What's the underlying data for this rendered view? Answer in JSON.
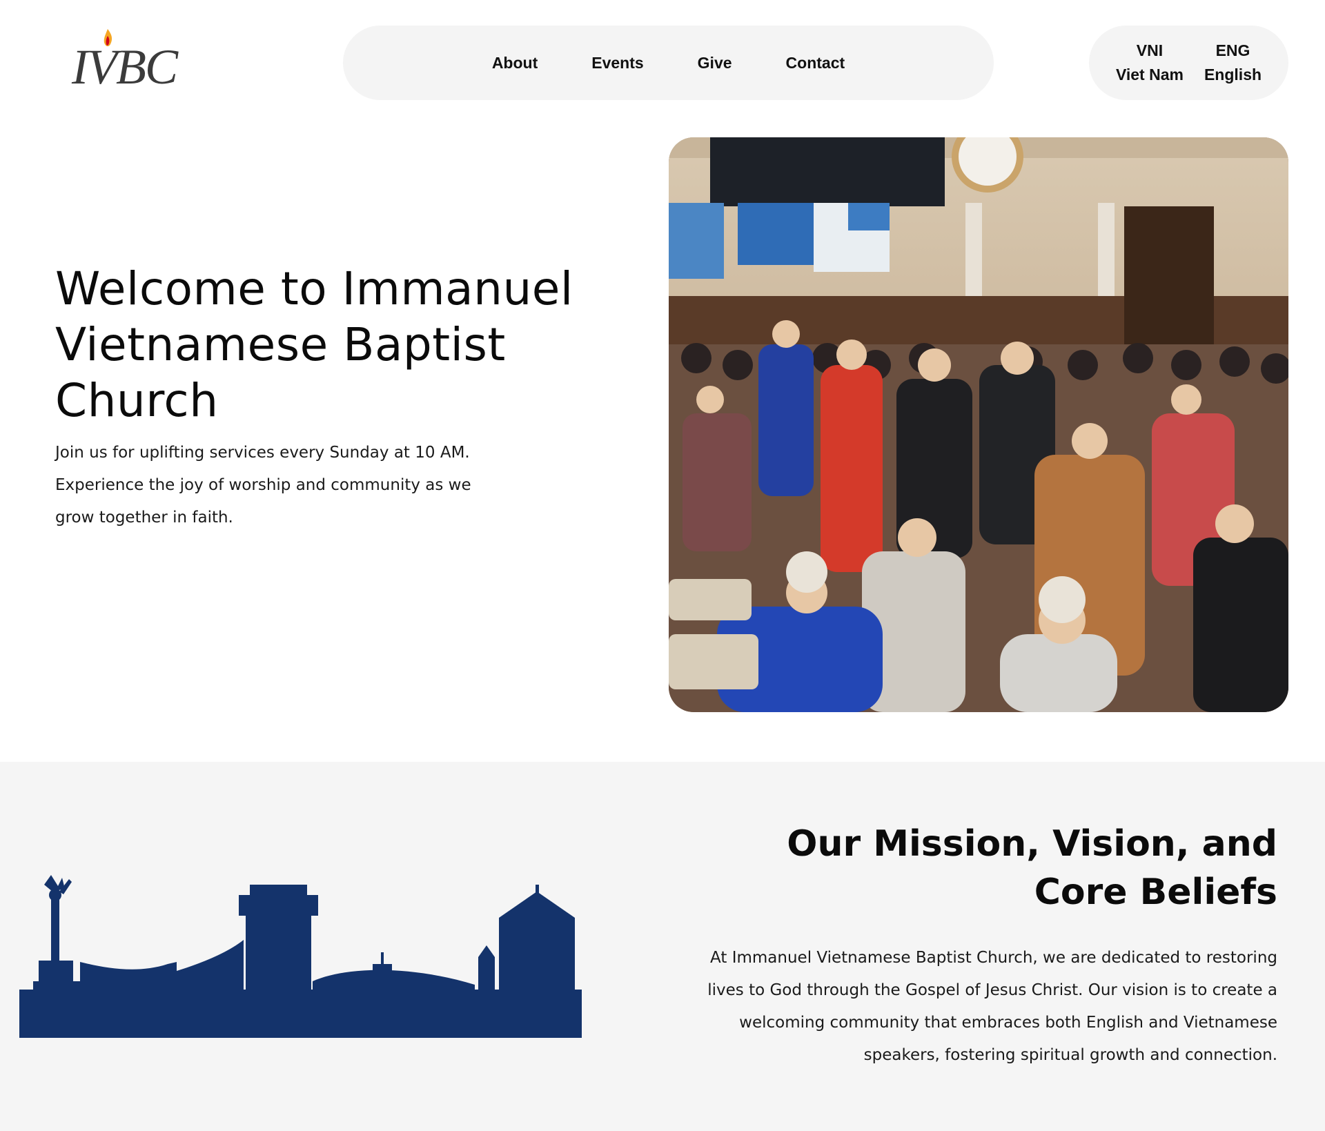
{
  "brand": {
    "logo_text": "IVBC",
    "flame_colors": [
      "#f5a623",
      "#d0021b"
    ]
  },
  "nav": {
    "items": [
      {
        "label": "About"
      },
      {
        "label": "Events"
      },
      {
        "label": "Give"
      },
      {
        "label": "Contact"
      }
    ]
  },
  "language": {
    "options": [
      {
        "code": "VNI",
        "name": "Viet Nam"
      },
      {
        "code": "ENG",
        "name": "English"
      }
    ]
  },
  "hero": {
    "title": "Welcome to Immanuel Vietnamese Baptist Church",
    "text": "Join us for uplifting services every Sunday at 10 AM. Experience the joy of worship and community as we grow together in faith.",
    "photo_icon": "congregation-photo"
  },
  "mission": {
    "title": "Our Mission, Vision, and Core Beliefs",
    "text": "At Immanuel Vietnamese Baptist Church, we are dedicated to restoring lives to God through the Gospel of Jesus Christ. Our vision is to create a welcoming community that embraces both English and Vietnamese speakers, fostering spiritual growth and connection.",
    "skyline_color": "#14336b"
  }
}
